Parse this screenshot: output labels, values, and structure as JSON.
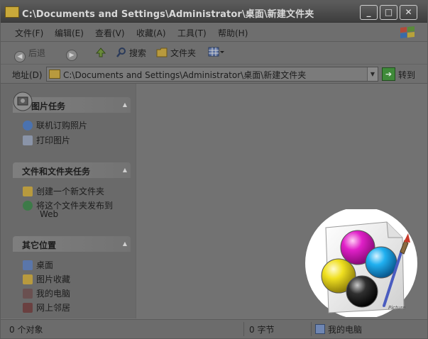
{
  "window": {
    "title": "C:\\Documents and Settings\\Administrator\\桌面\\新建文件夹",
    "controls": [
      "_",
      "□",
      "✕"
    ]
  },
  "menu": [
    "文件(F)",
    "编辑(E)",
    "查看(V)",
    "收藏(A)",
    "工具(T)",
    "帮助(H)"
  ],
  "toolbar": {
    "back": "后退",
    "search": "搜索",
    "folders": "文件夹"
  },
  "address": {
    "label": "地址(D)",
    "value": "C:\\Documents and Settings\\Administrator\\桌面\\新建文件夹",
    "go": "转到"
  },
  "panels": [
    {
      "title": "图片任务",
      "items": [
        "联机订购照片",
        "打印图片"
      ]
    },
    {
      "title": "文件和文件夹任务",
      "items": [
        "创建一个新文件夹",
        "将这个文件夹发布到",
        "Web"
      ]
    },
    {
      "title": "其它位置",
      "items": [
        "桌面",
        "图片收藏",
        "我的电脑",
        "网上邻居"
      ]
    }
  ],
  "status": {
    "objects": "0 个对象",
    "size": "0 字节",
    "location": "我的电脑"
  },
  "logo": {
    "label": "Picture",
    "colors": {
      "magenta": "#e020c8",
      "cyan": "#20b0f0",
      "yellow": "#f0e020",
      "black": "#303030"
    }
  }
}
